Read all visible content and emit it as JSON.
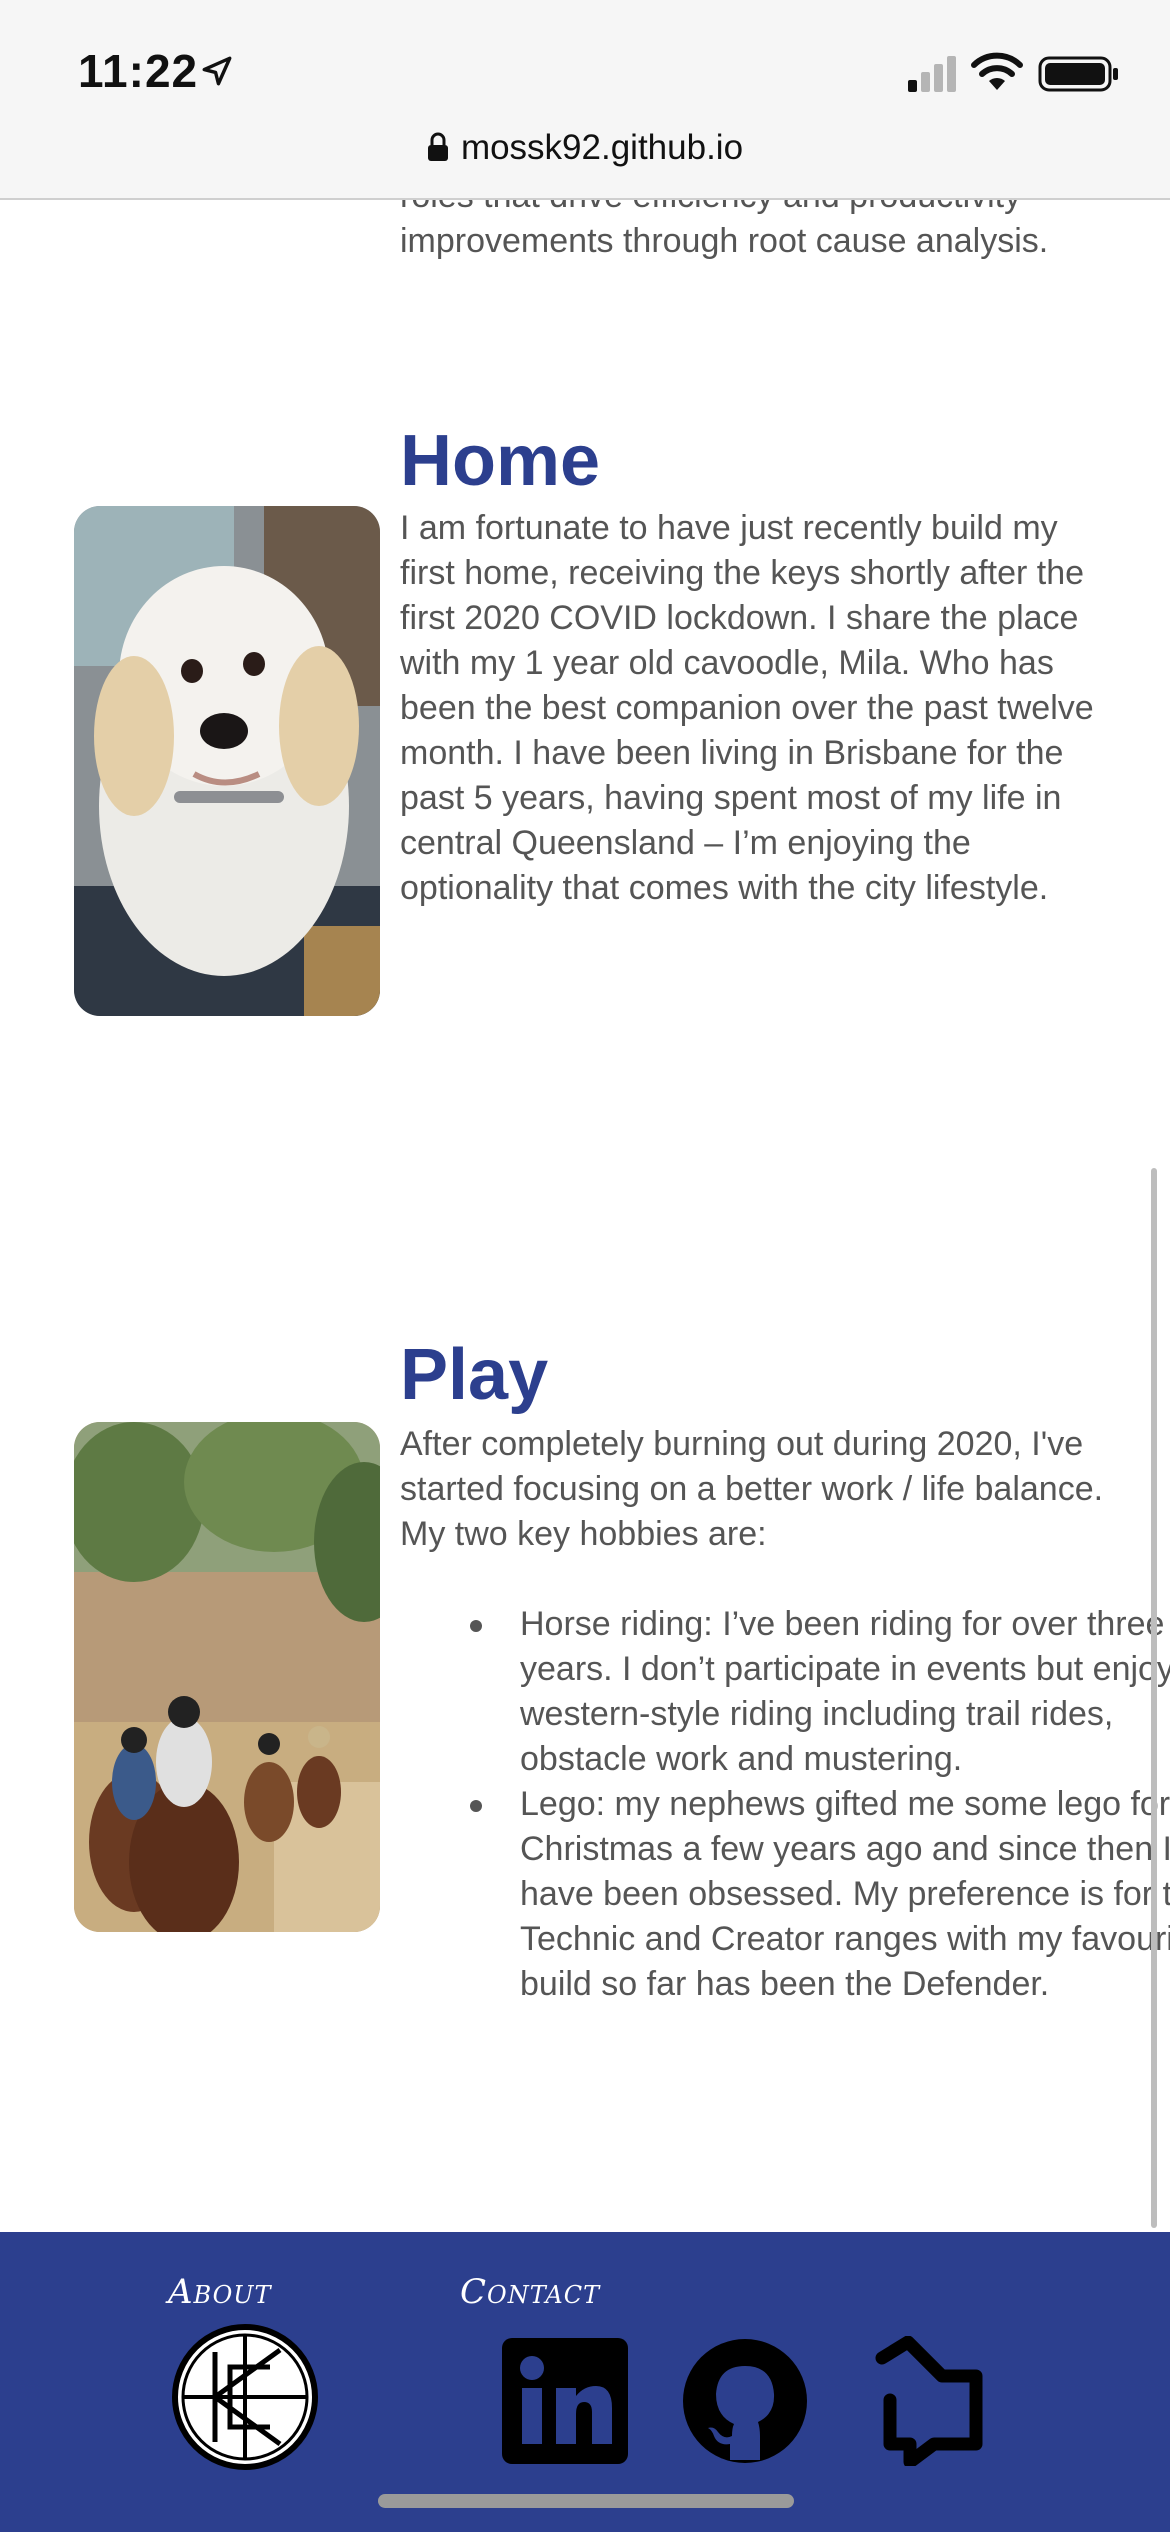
{
  "status_bar": {
    "time": "11:22"
  },
  "browser": {
    "url": "mossk92.github.io"
  },
  "intro": {
    "text": "roles that drive efficiency and productivity improvements through root cause analysis."
  },
  "home": {
    "title": "Home",
    "image_alt": "White cavoodle dog",
    "text": "I am fortunate to have just recently build my first home, receiving the keys shortly after the first 2020 COVID lockdown. I share the place with my 1 year old cavoodle, Mila. Who has been the best companion over the past twelve month. I have been living in Brisbane for the past 5 years, having spent most of my life in central Queensland – I’m enjoying the optionality that comes with the city lifestyle."
  },
  "play": {
    "title": "Play",
    "image_alt": "Group horse trail ride",
    "intro": "After completely burning out during 2020, I've started focusing on a better work / life balance. My two key hobbies are:",
    "hobbies": [
      "Horse riding: I’ve been riding for over three years. I don’t participate in events but enjoy western-style riding including trail rides, obstacle work and mustering.",
      "Lego: my nephews gifted me some lego for Christmas a few years ago and since then I have been obsessed. My preference is for the Technic and Creator ranges with my favourite build so far has been the Defender."
    ]
  },
  "footer": {
    "about_label": "About",
    "contact_label": "Contact",
    "icons": [
      "kc-logo-icon",
      "linkedin-icon",
      "github-icon",
      "blog-edit-icon"
    ]
  },
  "colors": {
    "accent": "#2c3f8e",
    "body_text": "#555555"
  }
}
